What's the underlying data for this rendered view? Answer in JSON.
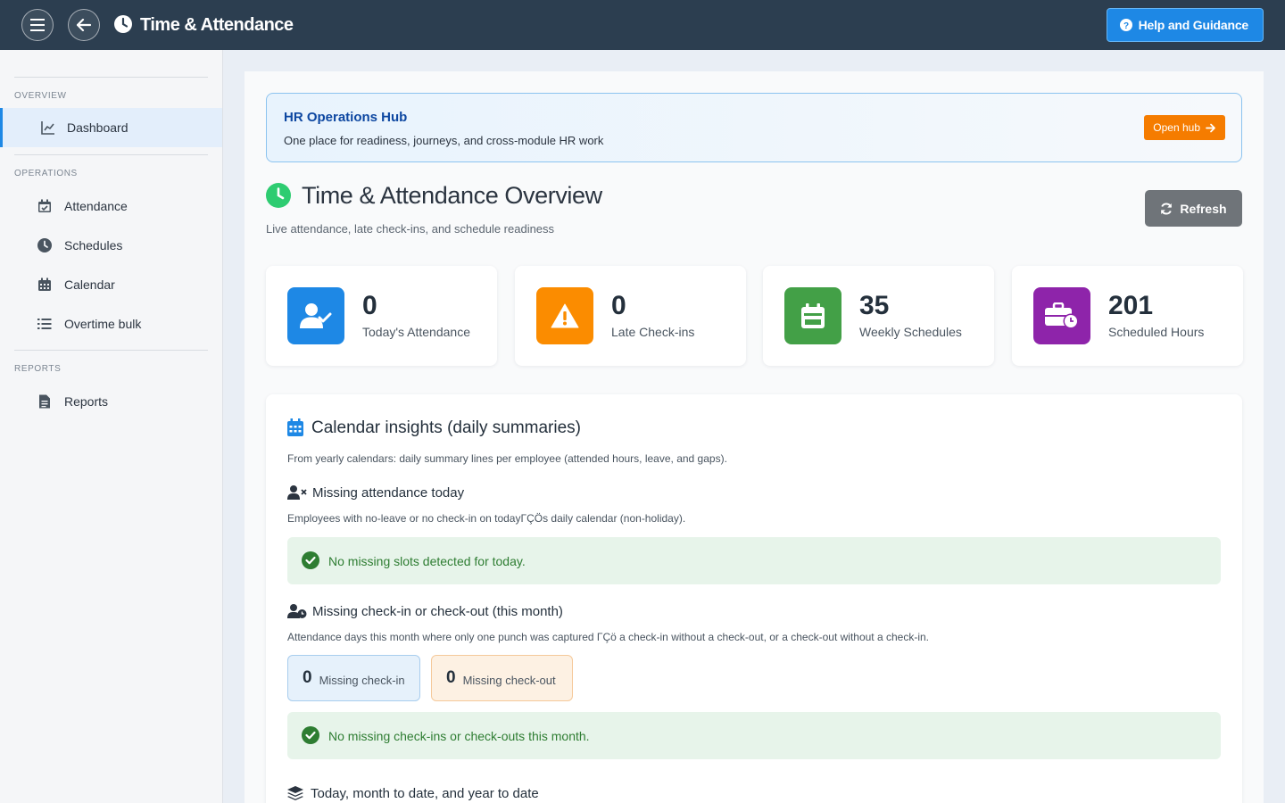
{
  "topbar": {
    "title": "Time & Attendance",
    "help_label": "Help and Guidance",
    "icons": [
      "menu-icon",
      "back-arrow-icon",
      "clock-icon",
      "question-circle-icon"
    ]
  },
  "sidebar": {
    "sections": [
      {
        "label": "OVERVIEW",
        "items": [
          {
            "label": "Dashboard",
            "icon": "chart-line-icon",
            "active": true
          }
        ]
      },
      {
        "label": "OPERATIONS",
        "items": [
          {
            "label": "Attendance",
            "icon": "calendar-check-icon"
          },
          {
            "label": "Schedules",
            "icon": "clock-icon"
          },
          {
            "label": "Calendar",
            "icon": "calendar-icon"
          },
          {
            "label": "Overtime bulk",
            "icon": "list-icon"
          }
        ]
      },
      {
        "label": "REPORTS",
        "items": [
          {
            "label": "Reports",
            "icon": "file-icon"
          }
        ]
      }
    ]
  },
  "hub": {
    "title": "HR Operations Hub",
    "subtitle": "One place for readiness, journeys, and cross-module HR work",
    "button_label": "Open hub"
  },
  "overview": {
    "title": "Time & Attendance Overview",
    "subtitle": "Live attendance, late check-ins, and schedule readiness",
    "refresh_label": "Refresh"
  },
  "stats": [
    {
      "value": "0",
      "label": "Today's Attendance",
      "color": "#1e88e5",
      "icon": "user-check-icon"
    },
    {
      "value": "0",
      "label": "Late Check-ins",
      "color": "#fb8c00",
      "icon": "warning-icon"
    },
    {
      "value": "35",
      "label": "Weekly Schedules",
      "color": "#43a047",
      "icon": "calendar-icon"
    },
    {
      "value": "201",
      "label": "Scheduled Hours",
      "color": "#8e24aa",
      "icon": "briefcase-clock-icon"
    }
  ],
  "insights": {
    "title": "Calendar insights (daily summaries)",
    "subtitle": "From yearly calendars: daily summary lines per employee (attended hours, leave, and gaps).",
    "missing_today": {
      "title": "Missing attendance today",
      "subtitle": "Employees with no-leave or no check-in on todayΓÇÖs daily calendar (non-holiday).",
      "ok_text": "No missing slots detected for today."
    },
    "missing_punch": {
      "title": "Missing check-in or check-out (this month)",
      "subtitle": "Attendance days this month where only one punch was captured ΓÇö a check-in without a check-out, or a check-out without a check-in.",
      "check_in_count": "0",
      "check_in_label": "Missing check-in",
      "check_out_count": "0",
      "check_out_label": "Missing check-out",
      "ok_text": "No missing check-ins or check-outs this month."
    },
    "next_section_title": "Today, month to date, and year to date"
  },
  "colors": {
    "topbar": "#2c3e50",
    "accent": "#1e88e5",
    "hub_button": "#f57c00",
    "success": "#2e7d32"
  }
}
